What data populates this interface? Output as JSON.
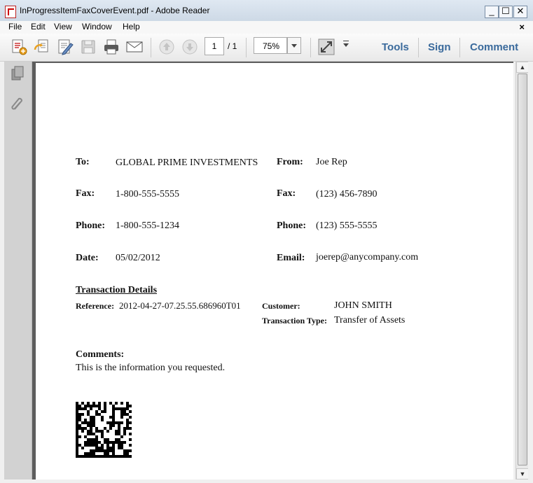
{
  "window": {
    "title": "InProgressItemFaxCoverEvent.pdf - Adobe Reader",
    "minimize": "_",
    "maximize": "☐",
    "close": "✕"
  },
  "menu": [
    "File",
    "Edit",
    "View",
    "Window",
    "Help"
  ],
  "menu_close_doc": "×",
  "toolbar": {
    "page_current": "1",
    "page_total": "/ 1",
    "zoom": "75%",
    "tools": "Tools",
    "sign": "Sign",
    "comment": "Comment"
  },
  "fax": {
    "to_label": "To:",
    "to_value": "GLOBAL PRIME INVESTMENTS",
    "from_label": "From:",
    "from_value": "Joe Rep",
    "fax_label": "Fax:",
    "fax_to": "1-800-555-5555",
    "fax_from": "(123) 456-7890",
    "phone_label": "Phone:",
    "phone_to": "1-800-555-1234",
    "phone_from": "(123) 555-5555",
    "date_label": "Date:",
    "date_value": "05/02/2012",
    "email_label": "Email:",
    "email_value": "joerep@anycompany.com",
    "transaction_heading": "Transaction Details",
    "reference_label": "Reference:",
    "reference_value": "2012-04-27-07.25.55.686960T01",
    "customer_label": "Customer:",
    "customer_value": "JOHN SMITH",
    "transaction_type_label": "Transaction Type:",
    "transaction_type_value": "Transfer of Assets",
    "comments_label": "Comments:",
    "comments_value": "This is the information you requested."
  },
  "icons": [
    "create-pdf-icon",
    "export-icon",
    "edit-icon",
    "save-icon",
    "print-icon",
    "email-icon",
    "page-up-icon",
    "page-down-icon",
    "zoom-dropdown-icon",
    "fit-window-icon",
    "more-tools-icon",
    "pages-panel-icon",
    "attachments-icon",
    "datamatrix-barcode"
  ]
}
